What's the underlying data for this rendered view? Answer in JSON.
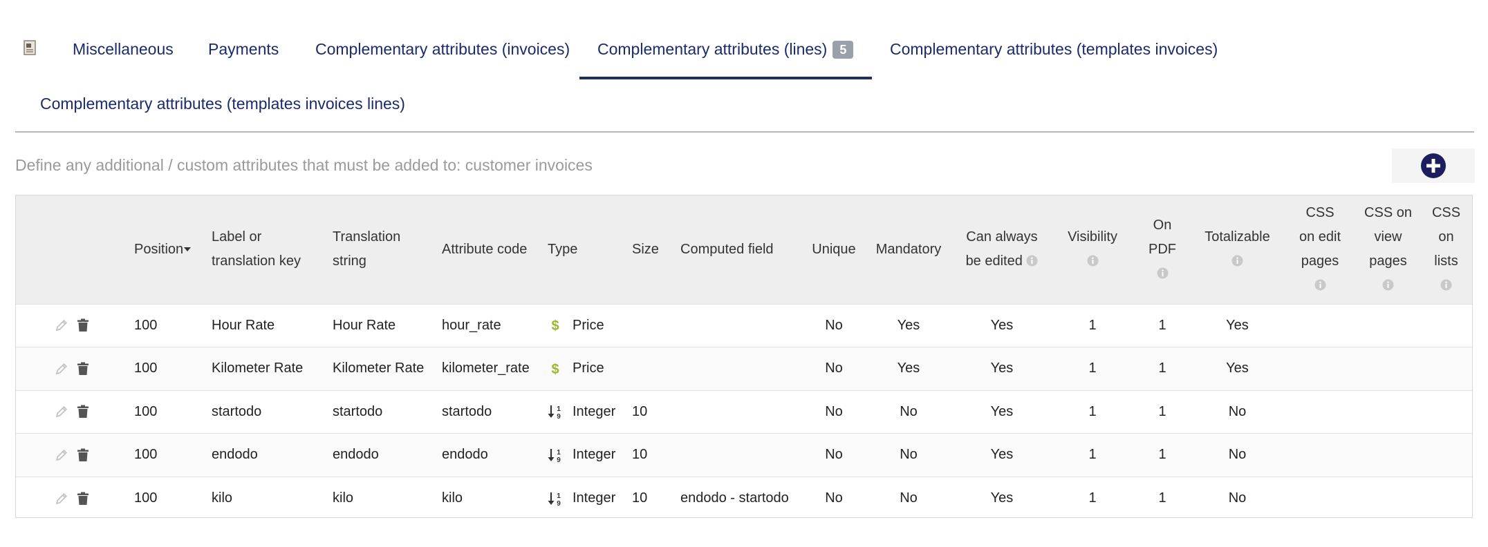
{
  "tabs": [
    {
      "label": "Miscellaneous"
    },
    {
      "label": "Payments"
    },
    {
      "label": "Complementary attributes (invoices)"
    },
    {
      "label": "Complementary attributes (lines)",
      "badge": "5",
      "active": true
    },
    {
      "label": "Complementary attributes (templates invoices)"
    },
    {
      "label": "Complementary attributes (templates invoices lines)"
    }
  ],
  "description": "Define any additional / custom attributes that must be added to: customer invoices",
  "table": {
    "headers": {
      "position": "Position",
      "label_1": "Label or",
      "label_2": "translation key",
      "translation_1": "Translation",
      "translation_2": "string",
      "attribute_code": "Attribute code",
      "type": "Type",
      "size": "Size",
      "computed": "Computed field",
      "unique": "Unique",
      "mandatory": "Mandatory",
      "edit_1": "Can always",
      "edit_2": "be edited",
      "visibility": "Visibility",
      "pdf_1": "On",
      "pdf_2": "PDF",
      "totalizable": "Totalizable",
      "css_edit_1": "CSS",
      "css_edit_2": "on edit",
      "css_edit_3": "pages",
      "css_view_1": "CSS on",
      "css_view_2": "view",
      "css_view_3": "pages",
      "css_list_1": "CSS",
      "css_list_2": "on",
      "css_list_3": "lists"
    },
    "rows": [
      {
        "position": "100",
        "label": "Hour Rate",
        "translation": "Hour Rate",
        "code": "hour_rate",
        "type": "Price",
        "type_icon": "dollar-icon",
        "size": "",
        "computed": "",
        "unique": "No",
        "mandatory": "Yes",
        "always_edit": "Yes",
        "visibility": "1",
        "pdf": "1",
        "totalizable": "Yes"
      },
      {
        "position": "100",
        "label": "Kilometer Rate",
        "translation": "Kilometer Rate",
        "code": "kilometer_rate",
        "type": "Price",
        "type_icon": "dollar-icon",
        "size": "",
        "computed": "",
        "unique": "No",
        "mandatory": "Yes",
        "always_edit": "Yes",
        "visibility": "1",
        "pdf": "1",
        "totalizable": "Yes"
      },
      {
        "position": "100",
        "label": "startodo",
        "translation": "startodo",
        "code": "startodo",
        "type": "Integer",
        "type_icon": "sort-numeric-icon",
        "size": "10",
        "computed": "",
        "unique": "No",
        "mandatory": "No",
        "always_edit": "Yes",
        "visibility": "1",
        "pdf": "1",
        "totalizable": "No"
      },
      {
        "position": "100",
        "label": "endodo",
        "translation": "endodo",
        "code": "endodo",
        "type": "Integer",
        "type_icon": "sort-numeric-icon",
        "size": "10",
        "computed": "",
        "unique": "No",
        "mandatory": "No",
        "always_edit": "Yes",
        "visibility": "1",
        "pdf": "1",
        "totalizable": "No"
      },
      {
        "position": "100",
        "label": "kilo",
        "translation": "kilo",
        "code": "kilo",
        "type": "Integer",
        "type_icon": "sort-numeric-icon",
        "size": "10",
        "computed": "endodo - startodo",
        "unique": "No",
        "mandatory": "No",
        "always_edit": "Yes",
        "visibility": "1",
        "pdf": "1",
        "totalizable": "No"
      }
    ]
  },
  "colors": {
    "tab_text": "#1b2a6b",
    "active_underline": "#1f2f5e",
    "badge_bg": "#9aa0aa",
    "add_button": "#1b1f5e",
    "price_icon": "#9ab82c",
    "header_bg": "#eeeeee"
  }
}
